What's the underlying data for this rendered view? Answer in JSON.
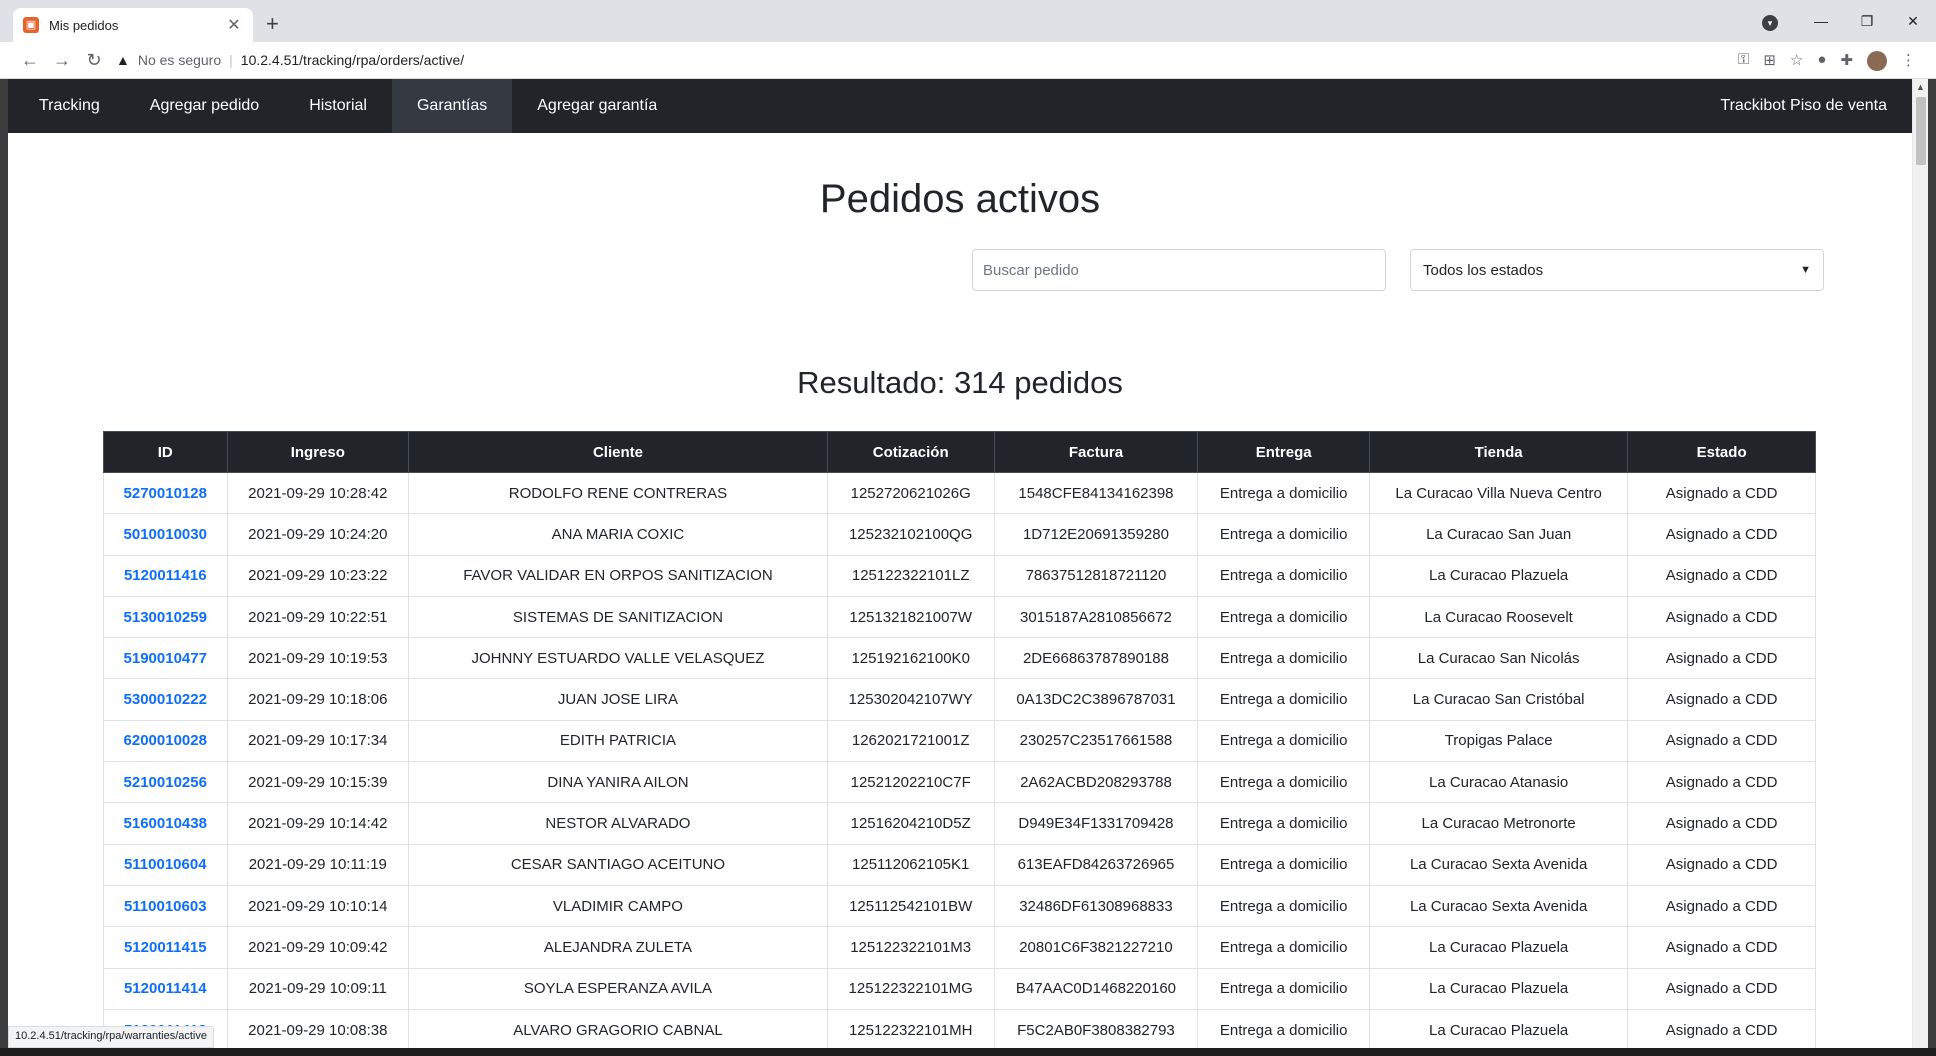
{
  "browser": {
    "tab_title": "Mis pedidos",
    "insecure_label": "No es seguro",
    "url": "10.2.4.51/tracking/rpa/orders/active/",
    "status_url": "10.2.4.51/tracking/rpa/warranties/active"
  },
  "navbar": {
    "items": [
      {
        "label": "Tracking"
      },
      {
        "label": "Agregar pedido"
      },
      {
        "label": "Historial"
      },
      {
        "label": "Garantías"
      },
      {
        "label": "Agregar garantía"
      }
    ],
    "brand": "Trackibot Piso de venta"
  },
  "page": {
    "title": "Pedidos activos",
    "search_placeholder": "Buscar pedido",
    "status_selected": "Todos los estados",
    "result": "Resultado: 314 pedidos"
  },
  "table": {
    "headers": [
      "ID",
      "Ingreso",
      "Cliente",
      "Cotización",
      "Factura",
      "Entrega",
      "Tienda",
      "Estado"
    ],
    "rows": [
      [
        "5270010128",
        "2021-09-29 10:28:42",
        "RODOLFO RENE CONTRERAS",
        "1252720621026G",
        "1548CFE84134162398",
        "Entrega a domicilio",
        "La Curacao Villa Nueva Centro",
        "Asignado a CDD"
      ],
      [
        "5010010030",
        "2021-09-29 10:24:20",
        "ANA MARIA COXIC",
        "125232102100QG",
        "1D712E20691359280",
        "Entrega a domicilio",
        "La Curacao San Juan",
        "Asignado a CDD"
      ],
      [
        "5120011416",
        "2021-09-29 10:23:22",
        "FAVOR VALIDAR EN ORPOS SANITIZACION",
        "125122322101LZ",
        "78637512818721120",
        "Entrega a domicilio",
        "La Curacao Plazuela",
        "Asignado a CDD"
      ],
      [
        "5130010259",
        "2021-09-29 10:22:51",
        "SISTEMAS DE SANITIZACION",
        "1251321821007W",
        "3015187A2810856672",
        "Entrega a domicilio",
        "La Curacao Roosevelt",
        "Asignado a CDD"
      ],
      [
        "5190010477",
        "2021-09-29 10:19:53",
        "JOHNNY ESTUARDO VALLE VELASQUEZ",
        "125192162100K0",
        "2DE66863787890188",
        "Entrega a domicilio",
        "La Curacao San Nicolás",
        "Asignado a CDD"
      ],
      [
        "5300010222",
        "2021-09-29 10:18:06",
        "JUAN JOSE LIRA",
        "125302042107WY",
        "0A13DC2C3896787031",
        "Entrega a domicilio",
        "La Curacao San Cristóbal",
        "Asignado a CDD"
      ],
      [
        "6200010028",
        "2021-09-29 10:17:34",
        "EDITH PATRICIA",
        "1262021721001Z",
        "230257C23517661588",
        "Entrega a domicilio",
        "Tropigas Palace",
        "Asignado a CDD"
      ],
      [
        "5210010256",
        "2021-09-29 10:15:39",
        "DINA YANIRA AILON",
        "12521202210C7F",
        "2A62ACBD208293788",
        "Entrega a domicilio",
        "La Curacao Atanasio",
        "Asignado a CDD"
      ],
      [
        "5160010438",
        "2021-09-29 10:14:42",
        "NESTOR ALVARADO",
        "12516204210D5Z",
        "D949E34F1331709428",
        "Entrega a domicilio",
        "La Curacao Metronorte",
        "Asignado a CDD"
      ],
      [
        "5110010604",
        "2021-09-29 10:11:19",
        "CESAR SANTIAGO ACEITUNO",
        "125112062105K1",
        "613EAFD84263726965",
        "Entrega a domicilio",
        "La Curacao Sexta Avenida",
        "Asignado a CDD"
      ],
      [
        "5110010603",
        "2021-09-29 10:10:14",
        "VLADIMIR CAMPO",
        "125112542101BW",
        "32486DF61308968833",
        "Entrega a domicilio",
        "La Curacao Sexta Avenida",
        "Asignado a CDD"
      ],
      [
        "5120011415",
        "2021-09-29 10:09:42",
        "ALEJANDRA ZULETA",
        "125122322101M3",
        "20801C6F3821227210",
        "Entrega a domicilio",
        "La Curacao Plazuela",
        "Asignado a CDD"
      ],
      [
        "5120011414",
        "2021-09-29 10:09:11",
        "SOYLA ESPERANZA AVILA",
        "125122322101MG",
        "B47AAC0D1468220160",
        "Entrega a domicilio",
        "La Curacao Plazuela",
        "Asignado a CDD"
      ],
      [
        "5120011413",
        "2021-09-29 10:08:38",
        "ALVARO GRAGORIO CABNAL",
        "125122322101MH",
        "F5C2AB0F3808382793",
        "Entrega a domicilio",
        "La Curacao Plazuela",
        "Asignado a CDD"
      ]
    ]
  }
}
